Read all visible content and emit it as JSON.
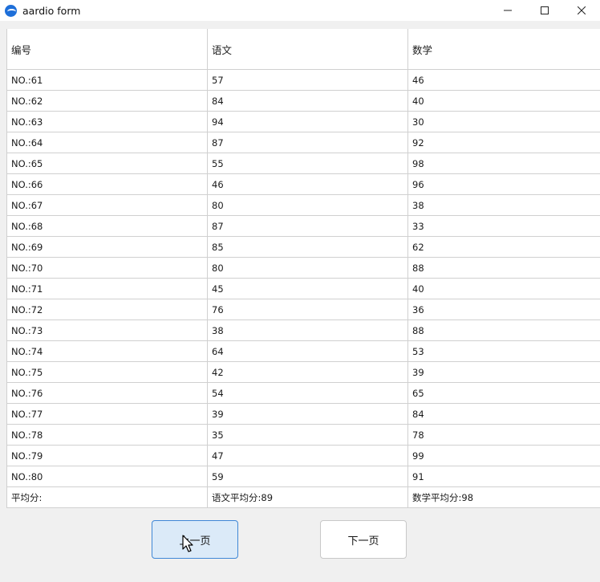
{
  "window": {
    "title": "aardio form"
  },
  "table": {
    "headers": [
      "编号",
      "语文",
      "数学"
    ],
    "rows": [
      [
        "NO.:61",
        "57",
        "46"
      ],
      [
        "NO.:62",
        "84",
        "40"
      ],
      [
        "NO.:63",
        "94",
        "30"
      ],
      [
        "NO.:64",
        "87",
        "92"
      ],
      [
        "NO.:65",
        "55",
        "98"
      ],
      [
        "NO.:66",
        "46",
        "96"
      ],
      [
        "NO.:67",
        "80",
        "38"
      ],
      [
        "NO.:68",
        "87",
        "33"
      ],
      [
        "NO.:69",
        "85",
        "62"
      ],
      [
        "NO.:70",
        "80",
        "88"
      ],
      [
        "NO.:71",
        "45",
        "40"
      ],
      [
        "NO.:72",
        "76",
        "36"
      ],
      [
        "NO.:73",
        "38",
        "88"
      ],
      [
        "NO.:74",
        "64",
        "53"
      ],
      [
        "NO.:75",
        "42",
        "39"
      ],
      [
        "NO.:76",
        "54",
        "65"
      ],
      [
        "NO.:77",
        "39",
        "84"
      ],
      [
        "NO.:78",
        "35",
        "78"
      ],
      [
        "NO.:79",
        "47",
        "99"
      ],
      [
        "NO.:80",
        "59",
        "91"
      ]
    ],
    "footer": [
      "平均分:",
      "语文平均分:89",
      "数学平均分:98"
    ]
  },
  "buttons": {
    "prev_label": "上一页",
    "next_label": "下一页"
  },
  "icons": {
    "app": "aardio-logo-icon",
    "minimize": "minimize-icon",
    "maximize": "maximize-icon",
    "close": "close-icon",
    "cursor": "mouse-pointer-icon"
  }
}
